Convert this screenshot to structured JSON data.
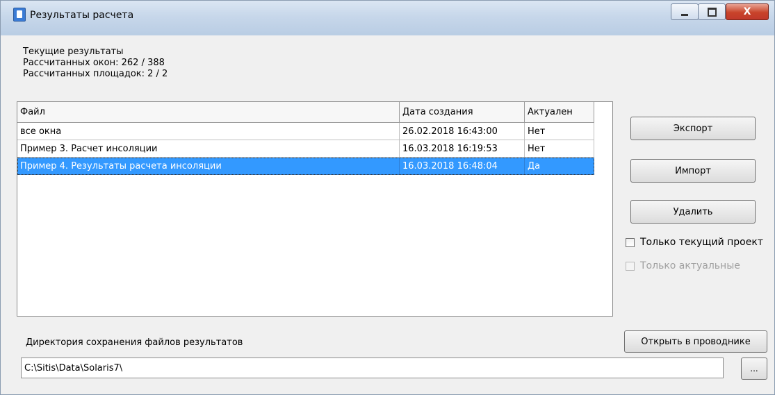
{
  "window": {
    "title": "Результаты расчета",
    "close_glyph": "X"
  },
  "info": {
    "line1": "Текущие результаты",
    "line2": "Рассчитанных окон: 262 / 388",
    "line3": "Рассчитанных площадок: 2 / 2"
  },
  "table": {
    "columns": [
      "Файл",
      "Дата создания",
      "Актуален"
    ],
    "rows": [
      {
        "file": "все окна",
        "date": "26.02.2018 16:43:00",
        "actual": "Нет"
      },
      {
        "file": "Пример 3. Расчет инсоляции",
        "date": "16.03.2018 16:19:53",
        "actual": "Нет"
      },
      {
        "file": "Пример 4. Результаты расчета инсоляции",
        "date": "16.03.2018 16:48:04",
        "actual": "Да"
      }
    ],
    "selected_row": 2
  },
  "actions": {
    "export": "Экспорт",
    "import": "Импорт",
    "delete": "Удалить",
    "only_current_project": "Только текущий проект",
    "only_actual": "Только актуальные"
  },
  "bottom": {
    "dir_label": "Директория сохранения файлов результатов",
    "open_explorer": "Открыть в проводнике",
    "path_value": "C:\\Sitis\\Data\\Solaris7\\",
    "browse": "..."
  },
  "icons": {
    "app": "app-icon",
    "minimize": "minimize-icon",
    "maximize": "maximize-icon",
    "close": "close-icon"
  }
}
